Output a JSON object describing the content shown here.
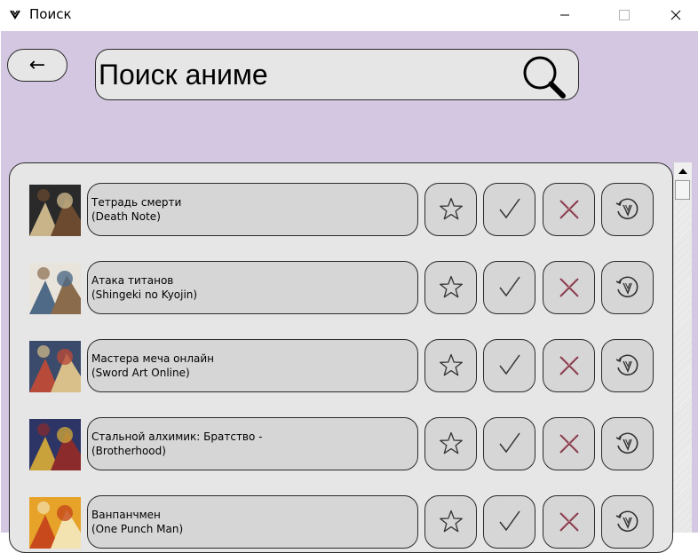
{
  "window": {
    "title": "Поиск",
    "buttons": [
      "minimize",
      "maximize",
      "close"
    ]
  },
  "header": {
    "back_label": "←",
    "search_placeholder": "Поиск аниме",
    "search_icon": "magnifier-icon"
  },
  "list": {
    "items": [
      {
        "title": "Тетрадь смерти\n(Death Note)",
        "thumb_colors": [
          "#2a2a2a",
          "#c9b48a",
          "#6b4a2f"
        ]
      },
      {
        "title": "Атака титанов\n(Shingeki no Kyojin)",
        "thumb_colors": [
          "#e8e4dc",
          "#4f6a86",
          "#8a6b4c"
        ]
      },
      {
        "title": "Мастера меча онлайн\n(Sword Art Online)",
        "thumb_colors": [
          "#3a4b6b",
          "#b84a3a",
          "#d9c08a"
        ]
      },
      {
        "title": "Стальной алхимик: Братство -\n(Brotherhood)",
        "thumb_colors": [
          "#2d3566",
          "#c9a23b",
          "#8c2b2b"
        ]
      },
      {
        "title": "Ванпанчмен\n(One Punch Man)",
        "thumb_colors": [
          "#e6a229",
          "#c84a1c",
          "#f2e3b0"
        ]
      }
    ],
    "actions": [
      {
        "name": "favorite",
        "icon": "star-icon"
      },
      {
        "name": "watched",
        "icon": "check-icon"
      },
      {
        "name": "dropped",
        "icon": "cross-icon"
      },
      {
        "name": "rewatch",
        "icon": "replay-icon"
      }
    ]
  },
  "colors": {
    "background": "#d4c7e1",
    "panel": "#e6e6e6",
    "button": "#d6d6d6",
    "cross": "#7a2f3f"
  }
}
